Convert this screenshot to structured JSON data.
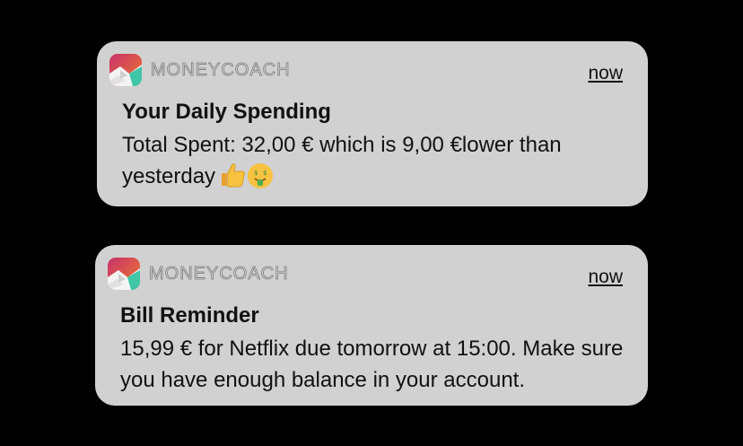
{
  "notifications": [
    {
      "app_name": "MONEYCOACH",
      "time": "now",
      "title": "Your Daily Spending",
      "body": "Total Spent: 32,00 € which is 9,00 €lower than yesterday",
      "emojis": [
        "thumbs-up-emoji",
        "money-mouth-face-emoji"
      ],
      "app_icon": "moneycoach-app-icon"
    },
    {
      "app_name": "MONEYCOACH",
      "time": "now",
      "title": "Bill Reminder",
      "body": "15,99 € for Netflix due tomorrow at 15:00. Make sure you have enough balance in your account.",
      "app_icon": "moneycoach-app-icon"
    }
  ],
  "colors": {
    "background": "#000000",
    "card": "#d1d1d1",
    "text": "#111111",
    "icon_gradient_top": "#e8446a",
    "icon_gradient_bottom": "#f07a2e",
    "icon_accent": "#3fc6a6"
  }
}
